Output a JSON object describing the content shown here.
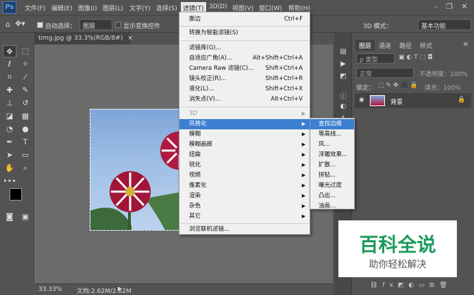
{
  "app": {
    "logo": "Ps"
  },
  "menubar": {
    "items": [
      "文件(F)",
      "编辑(E)",
      "图像(I)",
      "图层(L)",
      "文字(Y)",
      "选择(S)",
      "滤镜(T)",
      "3D(D)",
      "视图(V)",
      "窗口(W)",
      "帮助(H)"
    ],
    "active": "滤镜(T)"
  },
  "options": {
    "auto_select_label": "自动选择：",
    "auto_select_value": "图层",
    "transform_label": "显示变换控件",
    "mode_label": "3D 模式：",
    "workspace": "基本功能"
  },
  "document": {
    "tab_title": "timg.jpg @ 33.3%(RGB/8#)",
    "zoom": "33.33%",
    "doc_info": "文档:2.62M/2.62M"
  },
  "panel": {
    "tabs": [
      "图层",
      "通道",
      "路径",
      "样式"
    ],
    "kind_placeholder": "ρ 类型",
    "blend_mode": "正常",
    "opacity_label": "不透明度：100%",
    "lock_label": "锁定：",
    "fill_label": "填充：100%",
    "layer_name": "背景"
  },
  "filter_menu": {
    "items": [
      {
        "label": "撕边",
        "shortcut": "Ctrl+F"
      },
      {
        "label": "转换为智能滤镜(S)",
        "shortcut": ""
      },
      {
        "label": "滤镜库(G)...",
        "shortcut": ""
      },
      {
        "label": "自适应广角(A)...",
        "shortcut": "Alt+Shift+Ctrl+A"
      },
      {
        "label": "Camera Raw 滤镜(C)...",
        "shortcut": "Shift+Ctrl+A"
      },
      {
        "label": "镜头校正(R)...",
        "shortcut": "Shift+Ctrl+R"
      },
      {
        "label": "液化(L)...",
        "shortcut": "Shift+Ctrl+X"
      },
      {
        "label": "消失点(V)...",
        "shortcut": "Alt+Ctrl+V"
      },
      {
        "label": "3D"
      },
      {
        "label": "风格化"
      },
      {
        "label": "模糊"
      },
      {
        "label": "模糊画廊"
      },
      {
        "label": "扭曲"
      },
      {
        "label": "锐化"
      },
      {
        "label": "视频"
      },
      {
        "label": "像素化"
      },
      {
        "label": "渲染"
      },
      {
        "label": "杂色"
      },
      {
        "label": "其它"
      },
      {
        "label": "浏览联机滤镜..."
      }
    ]
  },
  "stylize_submenu": {
    "items": [
      "查找边缘",
      "等高线...",
      "风...",
      "浮雕效果...",
      "扩散...",
      "拼贴...",
      "曝光过度",
      "凸出...",
      "油画..."
    ]
  },
  "watermark": {
    "title": "百科全说",
    "subtitle": "助你轻松解决"
  }
}
